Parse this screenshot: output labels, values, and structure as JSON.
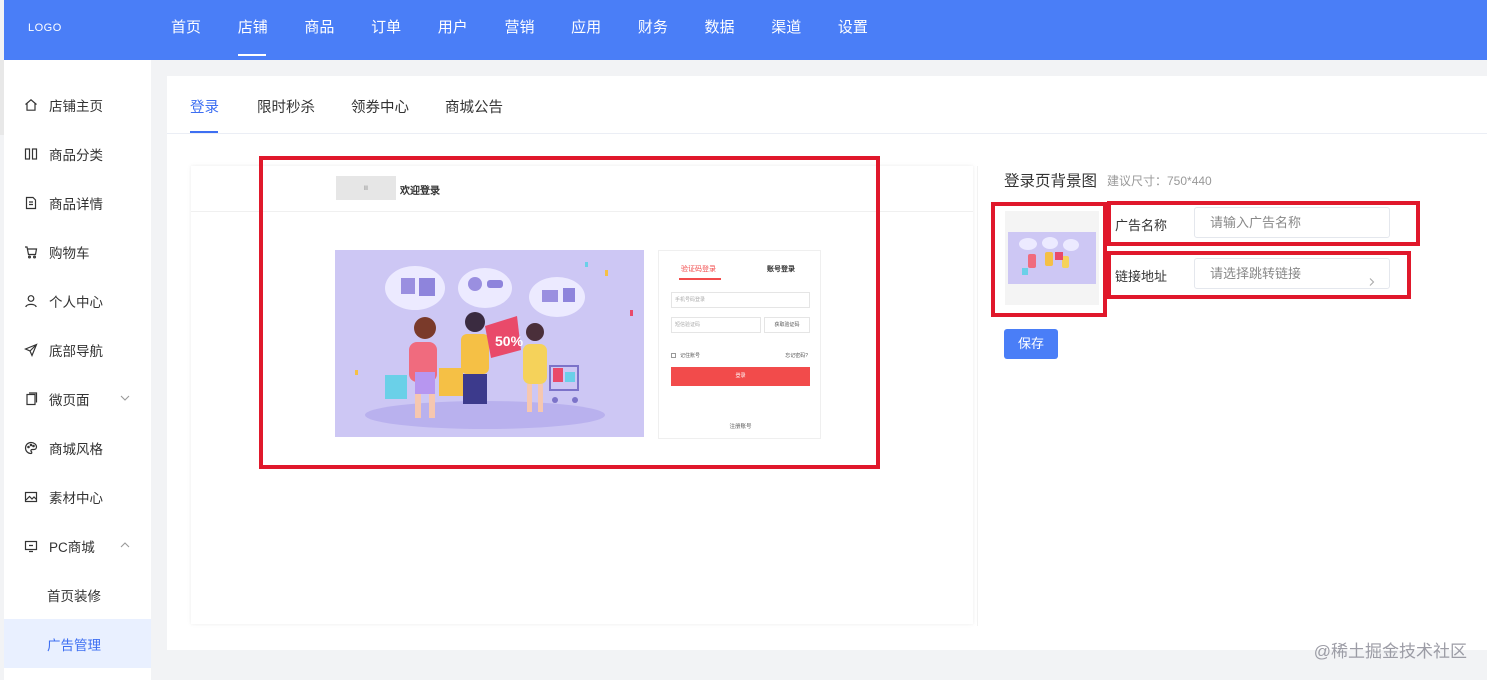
{
  "app": {
    "logo_text": "LOGO",
    "brand_color": "#4a7ef7",
    "highlight_color": "#e0182b"
  },
  "topnav": {
    "items": [
      {
        "label": "首页"
      },
      {
        "label": "店铺",
        "active": true
      },
      {
        "label": "商品"
      },
      {
        "label": "订单"
      },
      {
        "label": "用户"
      },
      {
        "label": "营销"
      },
      {
        "label": "应用"
      },
      {
        "label": "财务"
      },
      {
        "label": "数据"
      },
      {
        "label": "渠道"
      },
      {
        "label": "设置"
      }
    ]
  },
  "sidebar": {
    "items": [
      {
        "label": "店铺主页",
        "icon": "home-icon"
      },
      {
        "label": "商品分类",
        "icon": "columns-icon"
      },
      {
        "label": "商品详情",
        "icon": "document-icon"
      },
      {
        "label": "购物车",
        "icon": "cart-icon"
      },
      {
        "label": "个人中心",
        "icon": "user-icon"
      },
      {
        "label": "底部导航",
        "icon": "send-icon"
      },
      {
        "label": "微页面",
        "icon": "pages-icon",
        "expandable": true
      },
      {
        "label": "商城风格",
        "icon": "palette-icon"
      },
      {
        "label": "素材中心",
        "icon": "image-icon"
      },
      {
        "label": "PC商城",
        "icon": "monitor-icon",
        "expanded": true
      }
    ],
    "sub_items": [
      {
        "label": "首页装修"
      },
      {
        "label": "广告管理",
        "active": true
      }
    ]
  },
  "tabs": [
    {
      "label": "登录",
      "active": true
    },
    {
      "label": "限时秒杀"
    },
    {
      "label": "领券中心"
    },
    {
      "label": "商城公告"
    }
  ],
  "preview": {
    "logo_placeholder": "Ⅲ",
    "welcome": "欢迎登录",
    "login_box": {
      "tab_sms": "验证码登录",
      "tab_account": "账号登录",
      "phone_placeholder": "手机号码登录",
      "code_placeholder": "短信验证码",
      "get_code": "获取验证码",
      "remember": "记住账号",
      "forgot": "忘记密码?",
      "submit": "登录",
      "register": "注册账号"
    },
    "illustration_badge": "50%"
  },
  "config": {
    "title": "登录页背景图",
    "size_hint": "建议尺寸：750*440",
    "ad_name_label": "广告名称",
    "ad_name_placeholder": "请输入广告名称",
    "link_label": "链接地址",
    "link_placeholder": "请选择跳转链接",
    "save": "保存"
  },
  "watermark": "@稀土掘金技术社区"
}
